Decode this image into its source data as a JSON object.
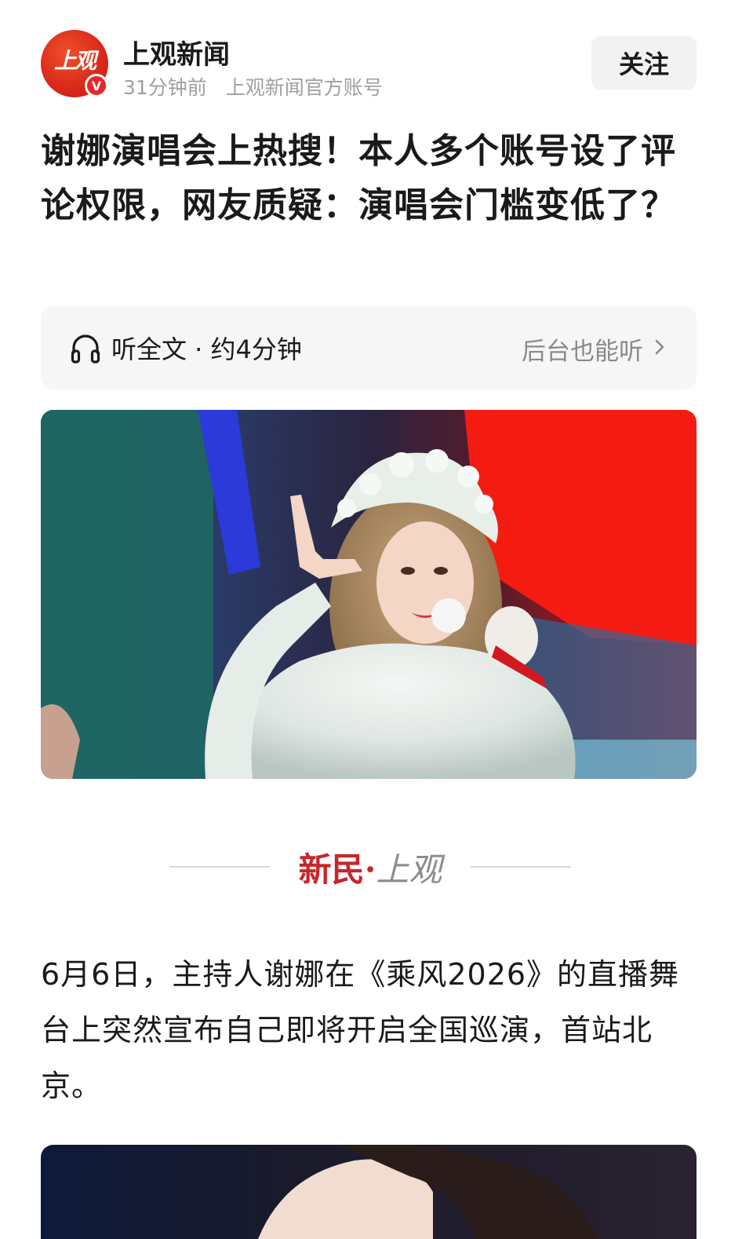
{
  "header": {
    "avatar_text": "上观",
    "verified_mark": "V",
    "source_name": "上观新闻",
    "time_ago": "31分钟前",
    "account_type": "上观新闻官方账号",
    "follow_label": "关注"
  },
  "article": {
    "title": "谢娜演唱会上热搜！本人多个账号设了评论权限，网友质疑：演唱会门槛变低了？",
    "listen_label": "听全文 · 约4分钟",
    "background_listen_label": "后台也能听",
    "brand_red": "新民",
    "brand_dot": "·",
    "brand_grey": "上观",
    "paragraph": "6月6日，主持人谢娜在《乘风2026》的直播舞台上突然宣布自己即将开启全国巡演，首站北京。"
  },
  "icons": {
    "headphone": "headphone-icon",
    "chevron": "chevron-right-icon",
    "verified": "verified-badge-icon"
  },
  "colors": {
    "brand_red": "#c8262a",
    "avatar_red": "#e0301c",
    "muted_text": "#a0a0a0"
  }
}
